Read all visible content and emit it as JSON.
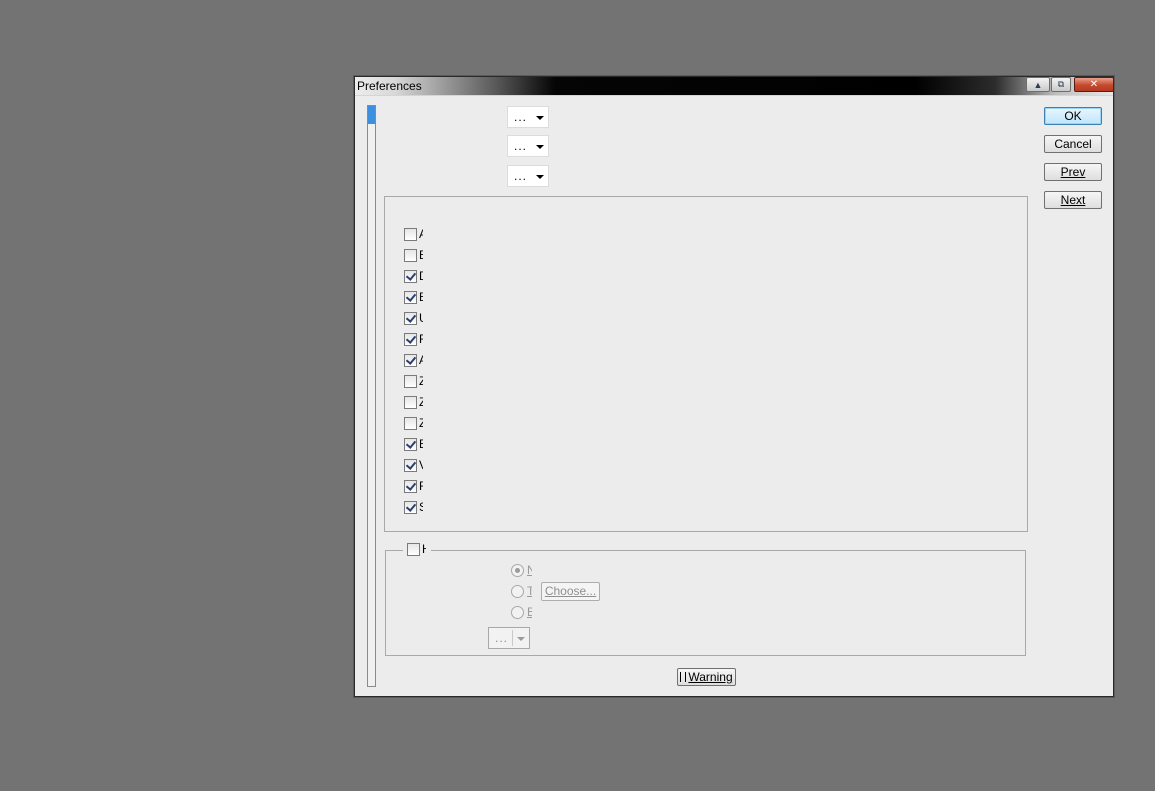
{
  "window": {
    "title": "Preferences",
    "controls": {
      "minimize": "▲",
      "restore": "⧉",
      "close": "✕"
    }
  },
  "top_combos": [
    {
      "value": "..."
    },
    {
      "value": "..."
    },
    {
      "value": "..."
    }
  ],
  "checklist": [
    {
      "label": "A",
      "checked": false
    },
    {
      "label": "B",
      "checked": false
    },
    {
      "label": "D",
      "checked": true
    },
    {
      "label": "E",
      "checked": true
    },
    {
      "label": "U",
      "checked": true
    },
    {
      "label": "F",
      "checked": true
    },
    {
      "label": "A",
      "checked": true
    },
    {
      "label": "Z",
      "checked": false
    },
    {
      "label": "Z",
      "checked": false
    },
    {
      "label": "Z",
      "checked": false
    },
    {
      "label": "E",
      "checked": true
    },
    {
      "label": "V",
      "checked": true
    },
    {
      "label": "F",
      "checked": true
    },
    {
      "label": "S",
      "checked": true
    }
  ],
  "group2": {
    "header_checkbox": {
      "label": "H",
      "checked": false
    },
    "radios": [
      {
        "label": "N",
        "selected": true
      },
      {
        "label": "T",
        "selected": false
      },
      {
        "label": "B",
        "selected": false
      }
    ],
    "choose_button": "Choose...",
    "combo": {
      "value": "..."
    }
  },
  "buttons": {
    "ok": "OK",
    "cancel": "Cancel",
    "prev": "Prev",
    "next": "Next",
    "warning": "Warning"
  }
}
